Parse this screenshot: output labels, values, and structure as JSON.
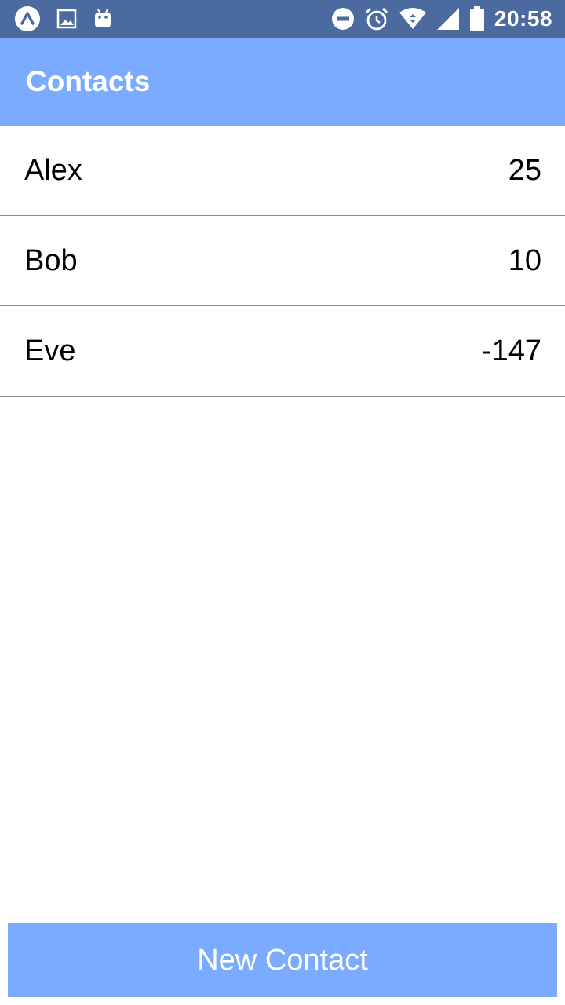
{
  "status_bar": {
    "time": "20:58",
    "left_icons": [
      "expo-icon",
      "image-icon",
      "android-icon"
    ],
    "right_icons": [
      "do-not-disturb-icon",
      "alarm-icon",
      "wifi-icon",
      "cell-signal-icon",
      "battery-icon"
    ],
    "background": "#4a6aa0"
  },
  "app_bar": {
    "title": "Contacts",
    "background": "#7aabfe"
  },
  "contacts": [
    {
      "name": "Alex",
      "value": "25"
    },
    {
      "name": "Bob",
      "value": "10"
    },
    {
      "name": "Eve",
      "value": "-147"
    }
  ],
  "footer": {
    "new_contact_label": "New Contact",
    "button_color": "#7aabfe"
  }
}
